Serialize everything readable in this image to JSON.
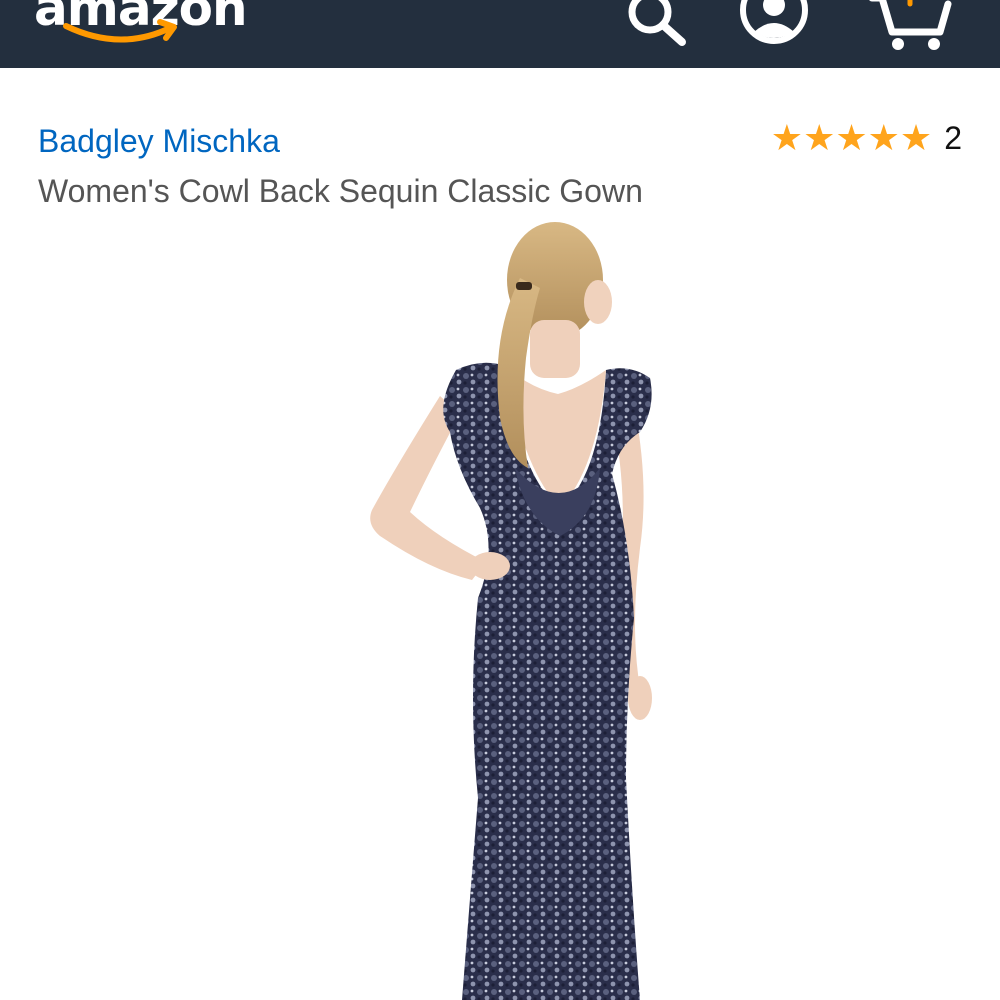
{
  "header": {
    "logo_text": "amazon",
    "bg_color": "#232f3e",
    "smile_color": "#ff9900",
    "icons": [
      "search-icon",
      "account-icon",
      "cart-icon"
    ]
  },
  "product": {
    "brand": "Badgley Mischka",
    "title": "Women's Cowl Back Sequin Classic Gown",
    "rating_stars": 5,
    "review_count": "2",
    "star_color": "#ffa41c",
    "brand_color": "#0066c0"
  },
  "image": {
    "subject": "model-in-navy-sequin-gown-back-view"
  }
}
